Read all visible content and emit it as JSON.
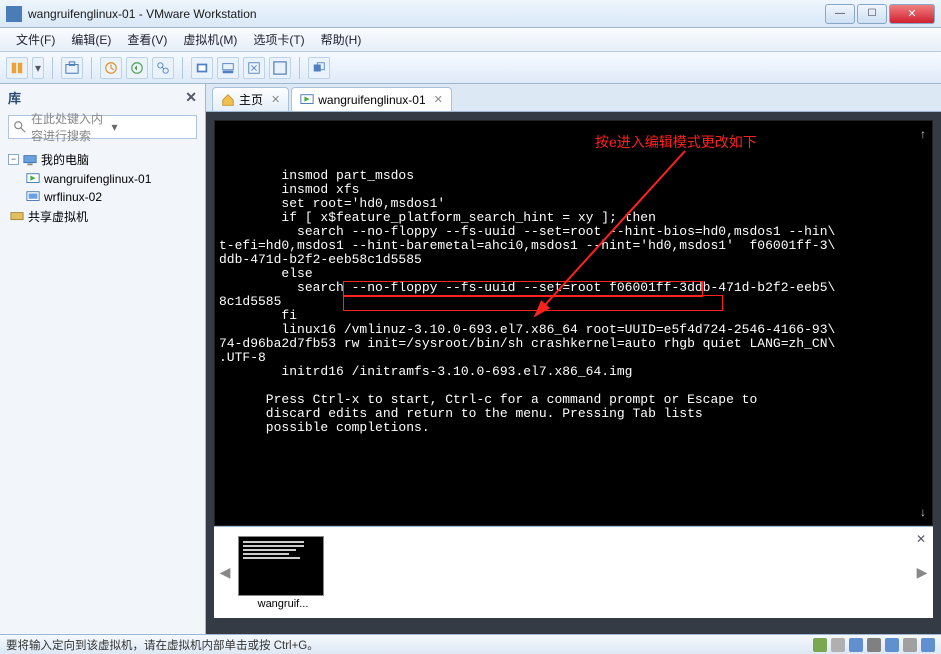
{
  "window": {
    "title": "wangruifenglinux-01 - VMware Workstation"
  },
  "menu": {
    "file": "文件(F)",
    "edit": "编辑(E)",
    "view": "查看(V)",
    "vm": "虚拟机(M)",
    "tabs": "选项卡(T)",
    "help": "帮助(H)"
  },
  "sidebar": {
    "title": "库",
    "search_placeholder": "在此处键入内容进行搜索",
    "root": "我的电脑",
    "items": [
      {
        "label": "wangruifenglinux-01"
      },
      {
        "label": "wrflinux-02"
      }
    ],
    "shared": "共享虚拟机"
  },
  "tabs": {
    "home": "主页",
    "vm": "wangruifenglinux-01"
  },
  "annotation": {
    "note": "按e进入编辑模式更改如下"
  },
  "console": {
    "text": "        insmod part_msdos\n        insmod xfs\n        set root='hd0,msdos1'\n        if [ x$feature_platform_search_hint = xy ]; then\n          search --no-floppy --fs-uuid --set=root --hint-bios=hd0,msdos1 --hin\\\nt-efi=hd0,msdos1 --hint-baremetal=ahci0,msdos1 --hint='hd0,msdos1'  f06001ff-3\\\nddb-471d-b2f2-eeb58c1d5585\n        else\n          search --no-floppy --fs-uuid --set=root f06001ff-3ddb-471d-b2f2-eeb5\\\n8c1d5585\n        fi\n        linux16 /vmlinuz-3.10.0-693.el7.x86_64 root=UUID=e5f4d724-2546-4166-93\\\n74-d96ba2d7fb53 rw init=/sysroot/bin/sh crashkernel=auto rhgb quiet LANG=zh_CN\\\n.UTF-8\n        initrd16 /initramfs-3.10.0-693.el7.x86_64.img\n\n      Press Ctrl-x to start, Ctrl-c for a command prompt or Escape to\n      discard edits and return to the menu. Pressing Tab lists\n      possible completions."
  },
  "thumb": {
    "label": "wangruif..."
  },
  "status": {
    "text": "要将输入定向到该虚拟机，请在虚拟机内部单击或按 Ctrl+G。"
  }
}
